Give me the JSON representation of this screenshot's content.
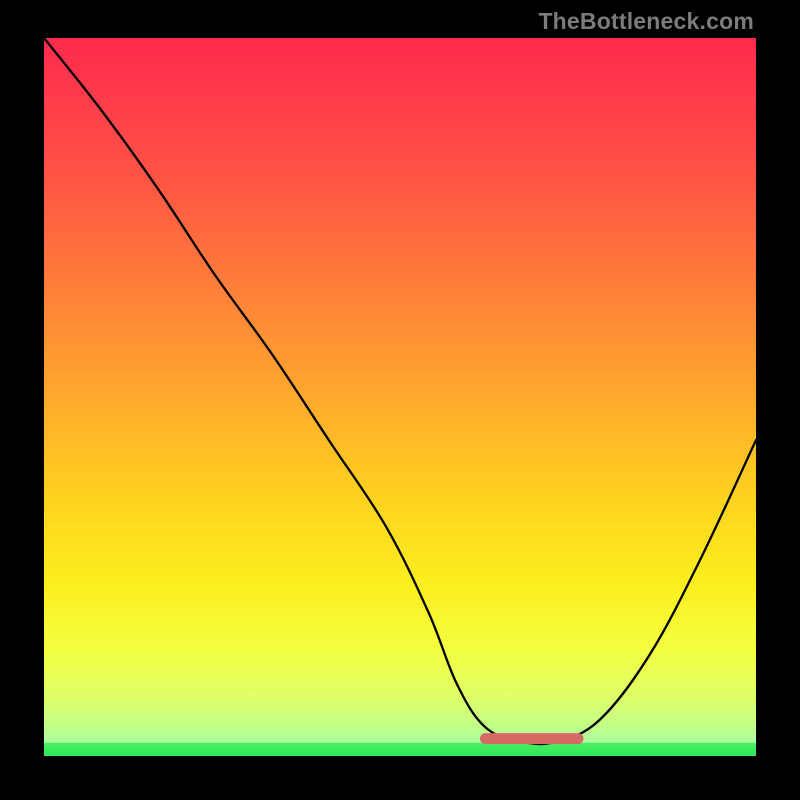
{
  "watermark": "TheBottleneck.com",
  "colors": {
    "gradient_top": "#ff2a4d",
    "gradient_mid1": "#ff7a3a",
    "gradient_mid2": "#ffd21e",
    "gradient_mid3": "#f4ff40",
    "gradient_bottom": "#2fe85a",
    "curve": "#000000",
    "highlight": "#d46a63",
    "frame": "#000000"
  },
  "chart_data": {
    "type": "line",
    "title": "",
    "xlabel": "",
    "ylabel": "",
    "xlim": [
      0,
      100
    ],
    "ylim": [
      0,
      100
    ],
    "legend": false,
    "grid": false,
    "series": [
      {
        "name": "bottleneck-curve",
        "x": [
          0,
          8,
          16,
          24,
          32,
          40,
          48,
          54,
          58,
          62,
          67,
          72,
          78,
          85,
          92,
          100
        ],
        "y": [
          100,
          90,
          79,
          67,
          56,
          44,
          32,
          20,
          10,
          4,
          2,
          2,
          5,
          14,
          27,
          44
        ]
      }
    ],
    "annotations": [
      {
        "name": "optimal-range",
        "type": "segment",
        "x_start": 62,
        "x_end": 75,
        "y": 2
      }
    ]
  }
}
